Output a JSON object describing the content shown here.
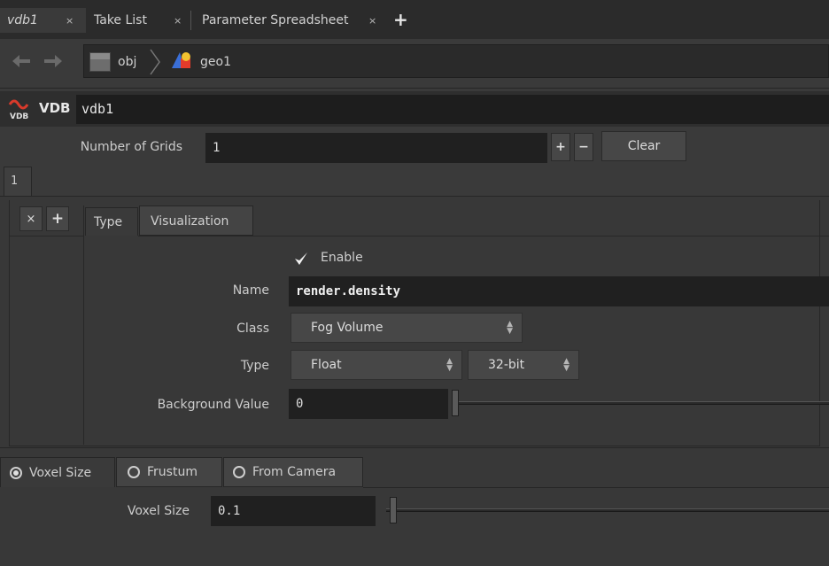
{
  "tabs": [
    {
      "label": "vdb1",
      "close": "×"
    },
    {
      "label": "Take List",
      "close": "×"
    },
    {
      "label": "Parameter Spreadsheet",
      "close": "×"
    }
  ],
  "new_tab_icon": "+",
  "path": {
    "back_icon": "arrow-left-icon",
    "forward_icon": "arrow-right-icon",
    "items": [
      {
        "label": "obj",
        "icon": "obj-network-icon"
      },
      {
        "label": "geo1",
        "icon": "geo-node-icon"
      }
    ]
  },
  "node": {
    "type_label": "VDB",
    "name": "vdb1",
    "icon_text": "VDB"
  },
  "grids": {
    "label": "Number of Grids",
    "value": "1",
    "plus": "+",
    "minus": "−",
    "clear": "Clear",
    "tab_index": "1"
  },
  "multiparm": {
    "remove": "×",
    "add": "+"
  },
  "inner_tabs": [
    "Type",
    "Visualization"
  ],
  "params": {
    "enable_label": "Enable",
    "enable_checked": true,
    "name_label": "Name",
    "name_value": "render.density",
    "class_label": "Class",
    "class_value": "Fog Volume",
    "type_label": "Type",
    "type_value": "Float",
    "precision_value": "32-bit",
    "bg_label": "Background Value",
    "bg_value": "0"
  },
  "voxel_tabs": [
    {
      "label": "Voxel Size",
      "selected": true
    },
    {
      "label": "Frustum",
      "selected": false
    },
    {
      "label": "From Camera",
      "selected": false
    }
  ],
  "voxel": {
    "label": "Voxel Size",
    "value": "0.1"
  }
}
